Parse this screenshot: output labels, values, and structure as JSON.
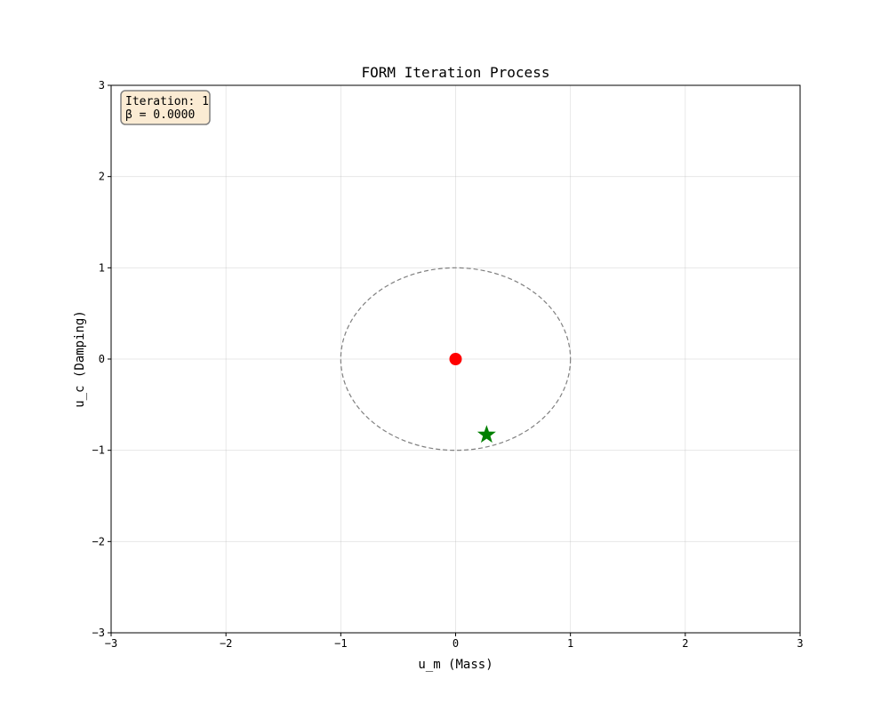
{
  "chart_data": {
    "type": "scatter",
    "title": "FORM Iteration Process",
    "xlabel": "u_m (Mass)",
    "ylabel": "u_c (Damping)",
    "xlim": [
      -3,
      3
    ],
    "ylim": [
      -3,
      3
    ],
    "xticks": [
      -3,
      -2,
      -1,
      0,
      1,
      2,
      3
    ],
    "yticks": [
      -3,
      -2,
      -1,
      0,
      1,
      2,
      3
    ],
    "xtick_labels": [
      "−3",
      "−2",
      "−1",
      "0",
      "1",
      "2",
      "3"
    ],
    "ytick_labels": [
      "−3",
      "−2",
      "−1",
      "0",
      "1",
      "2",
      "3"
    ],
    "grid": true,
    "circle": {
      "center": [
        0,
        0
      ],
      "radius": 1,
      "style": "dashed",
      "color": "#808080"
    },
    "series": [
      {
        "marker": "circle",
        "color": "#ff0000",
        "points": [
          [
            0,
            0
          ]
        ]
      },
      {
        "marker": "star",
        "color": "#008000",
        "points": [
          [
            0.27,
            -0.83
          ]
        ]
      }
    ],
    "annotation": {
      "lines": [
        "Iteration: 1",
        "β = 0.0000"
      ],
      "position": "top-left",
      "facecolor": "#fbebd3",
      "edgecolor": "#808080"
    }
  }
}
